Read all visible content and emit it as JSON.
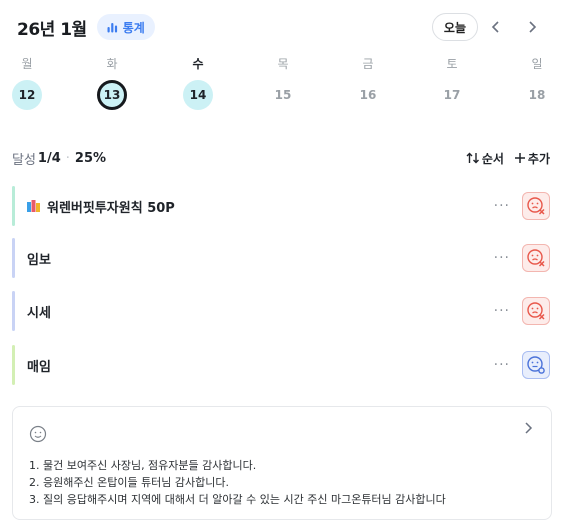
{
  "header": {
    "month": "26년 1월",
    "stats_label": "통계",
    "today_label": "오늘",
    "prev_icon": "chevron-left-icon",
    "next_icon": "chevron-right-icon"
  },
  "week": [
    {
      "dow": "월",
      "date": "12",
      "state": "done"
    },
    {
      "dow": "화",
      "date": "13",
      "state": "today"
    },
    {
      "dow": "수",
      "date": "14",
      "state": "done",
      "active": true
    },
    {
      "dow": "목",
      "date": "15",
      "state": "none"
    },
    {
      "dow": "금",
      "date": "16",
      "state": "none"
    },
    {
      "dow": "토",
      "date": "17",
      "state": "none"
    },
    {
      "dow": "일",
      "date": "18",
      "state": "none"
    }
  ],
  "summary": {
    "label": "달성",
    "count": "1/4",
    "dot": "·",
    "percent": "25%",
    "order_label": "순서",
    "add_label": "추가"
  },
  "tasks": [
    {
      "title": "워렌버핏투자원칙 50P",
      "color": "#b8ecd8",
      "status": "fail",
      "book_icon": true
    },
    {
      "title": "임보",
      "color": "#c9d3f5",
      "status": "fail"
    },
    {
      "title": "시세",
      "color": "#c9d3f5",
      "status": "fail"
    },
    {
      "title": "매임",
      "color": "#d3efb4",
      "status": "pending"
    }
  ],
  "more_label": "···",
  "memo": {
    "lines": [
      "1. 물건 보여주신 사장님, 점유자분들 감사합니다.",
      "2. 응원해주신 온탑이들 튜터님 감사합니다.",
      "3. 질의 응답해주시며 지역에 대해서 더 알아갈 수 있는 시간 주신 마그온튜터님 감사합니다"
    ]
  },
  "colors": {
    "accent": "#3b7cf0",
    "done_date_bg": "#ccf1f5",
    "fail_bg": "#fdecea",
    "fail_icon": "#e8574a",
    "pending_icon": "#4a72d9"
  }
}
